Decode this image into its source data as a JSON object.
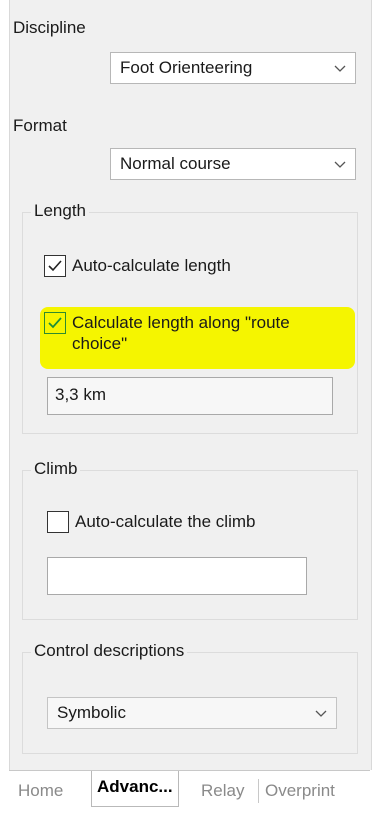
{
  "discipline": {
    "label": "Discipline",
    "value": "Foot Orienteering"
  },
  "format": {
    "label": "Format",
    "value": "Normal course"
  },
  "length": {
    "title": "Length",
    "auto_calc": {
      "label": "Auto-calculate length",
      "checked": true
    },
    "route_choice": {
      "label": "Calculate length along \"route choice\"",
      "checked": true
    },
    "value": "3,3 km"
  },
  "climb": {
    "title": "Climb",
    "auto_calc": {
      "label": "Auto-calculate the climb",
      "checked": false
    },
    "value": ""
  },
  "control_descriptions": {
    "title": "Control descriptions",
    "value": "Symbolic"
  },
  "tabs": [
    {
      "label": "Home"
    },
    {
      "label": "Advanc..."
    },
    {
      "label": "Relay"
    },
    {
      "label": "Overprint"
    }
  ],
  "colors": {
    "highlight": "#f5f500",
    "panel": "#f0f0f0",
    "checkbox_checked_highlight": "#00a651"
  }
}
